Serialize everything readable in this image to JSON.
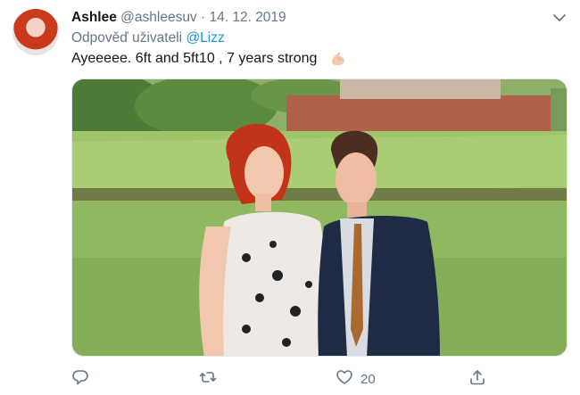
{
  "tweet": {
    "display_name": "Ashlee",
    "handle": "@ashleesuv",
    "separator": "·",
    "date": "14. 12. 2019",
    "reply_prefix": "Odpověď uživateli",
    "reply_to": "@Lizz",
    "text": "Ayeeeee. 6ft and 5ft10 , 7 years strong"
  },
  "actions": {
    "like_count": "20"
  },
  "icons": {
    "avatar": "user-avatar",
    "more": "chevron-down-icon",
    "emoji": "flexed-biceps-emoji",
    "reply": "reply-icon",
    "retweet": "retweet-icon",
    "like": "heart-icon",
    "share": "share-icon"
  },
  "colors": {
    "link": "#1b95e0",
    "muted": "#657786",
    "text": "#14171a"
  }
}
